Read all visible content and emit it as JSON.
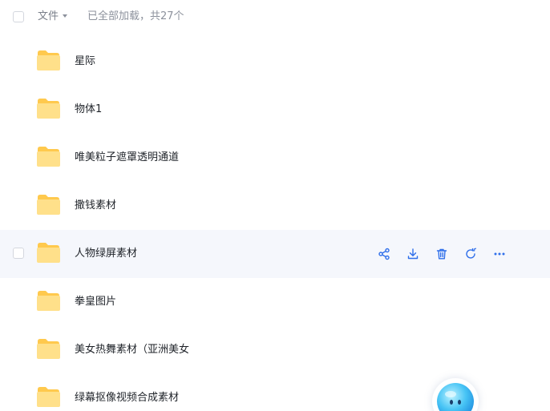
{
  "header": {
    "sort_label": "文件",
    "loaded_text": "已全部加载，共27个"
  },
  "rows": [
    {
      "name": "星际"
    },
    {
      "name": "物体1"
    },
    {
      "name": "唯美粒子遮罩透明通道"
    },
    {
      "name": "撒钱素材"
    },
    {
      "name": "人物绿屏素材"
    },
    {
      "name": "拳皇图片"
    },
    {
      "name": "美女热舞素材（亚洲美女"
    },
    {
      "name": "绿幕抠像视频合成素材"
    }
  ],
  "hover_row_index": 4,
  "row_actions": [
    "share-icon",
    "download-icon",
    "delete-icon",
    "refresh-icon",
    "more-icon"
  ],
  "colors": {
    "accent": "#2f6fea",
    "folder": "#ffd666",
    "hover_bg": "#f5f7fc",
    "text": "#1f2329",
    "muted": "#8c919c"
  }
}
